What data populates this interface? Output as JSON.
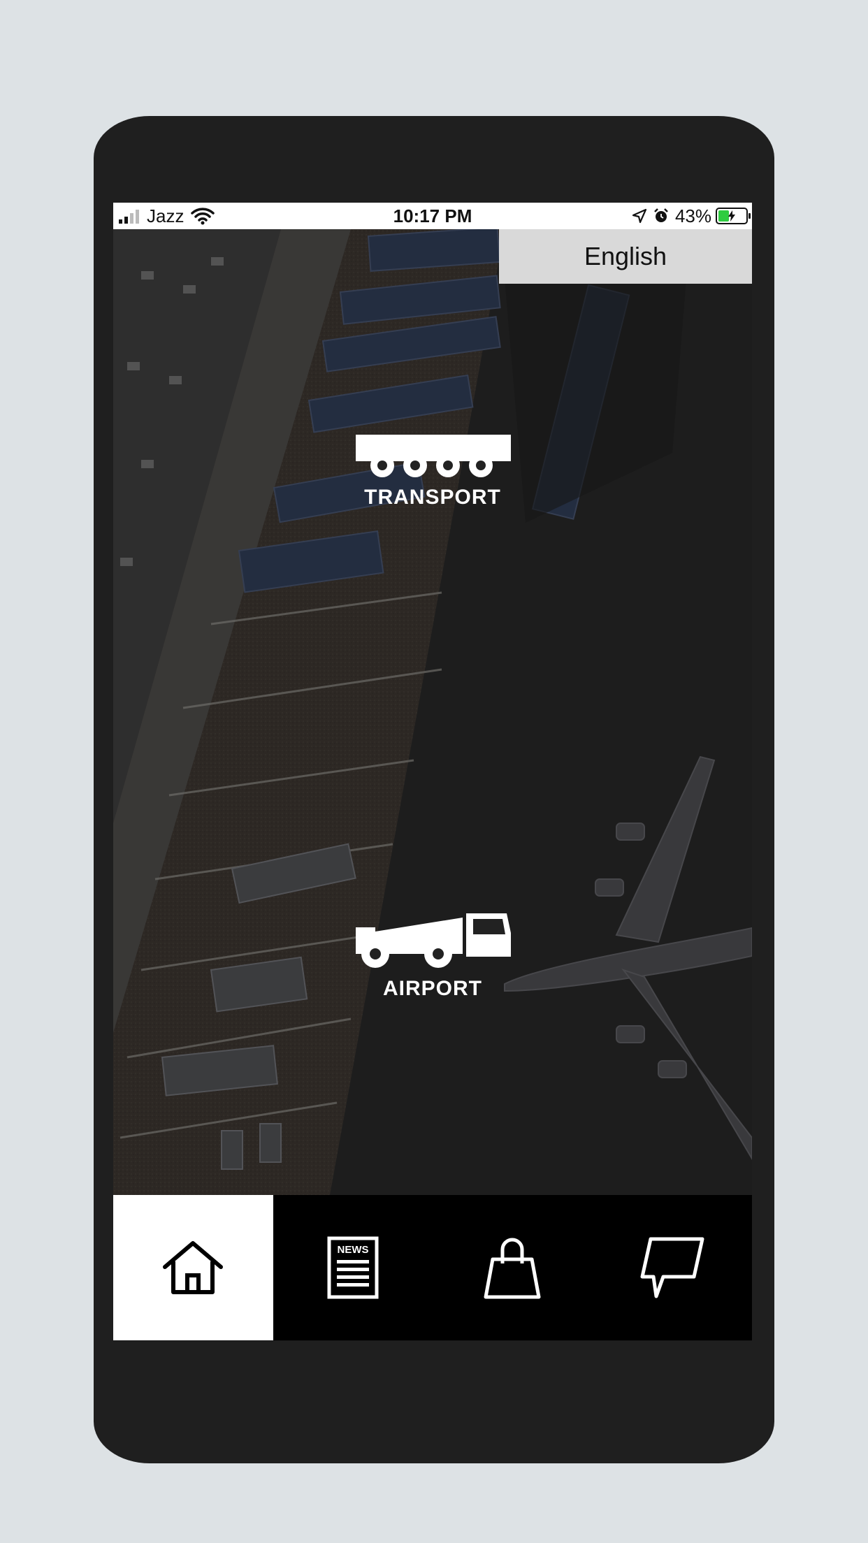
{
  "status_bar": {
    "carrier": "Jazz",
    "time": "10:17 PM",
    "battery_percent": "43%",
    "battery_level": 0.43,
    "icons": [
      "signal-icon",
      "wifi-icon",
      "location-icon",
      "alarm-icon",
      "battery-charging-icon"
    ]
  },
  "header": {
    "language_label": "English"
  },
  "menu": {
    "items": [
      {
        "label": "TRANSPORT",
        "icon": "transporter-icon"
      },
      {
        "label": "AIRPORT",
        "icon": "aircraft-tug-icon"
      }
    ]
  },
  "tabbar": {
    "active_index": 0,
    "tabs": [
      {
        "icon": "home-icon"
      },
      {
        "icon": "news-icon",
        "badge_text": "NEWS"
      },
      {
        "icon": "shopping-bag-icon"
      },
      {
        "icon": "chat-icon"
      }
    ]
  },
  "colors": {
    "backdrop": "#dde2e5",
    "device_frame": "#1f1f1f",
    "tab_active_bg": "#ffffff",
    "tabbar_bg": "#000000",
    "language_button_bg": "#d9d9d9",
    "battery_fill": "#2ecc40"
  }
}
